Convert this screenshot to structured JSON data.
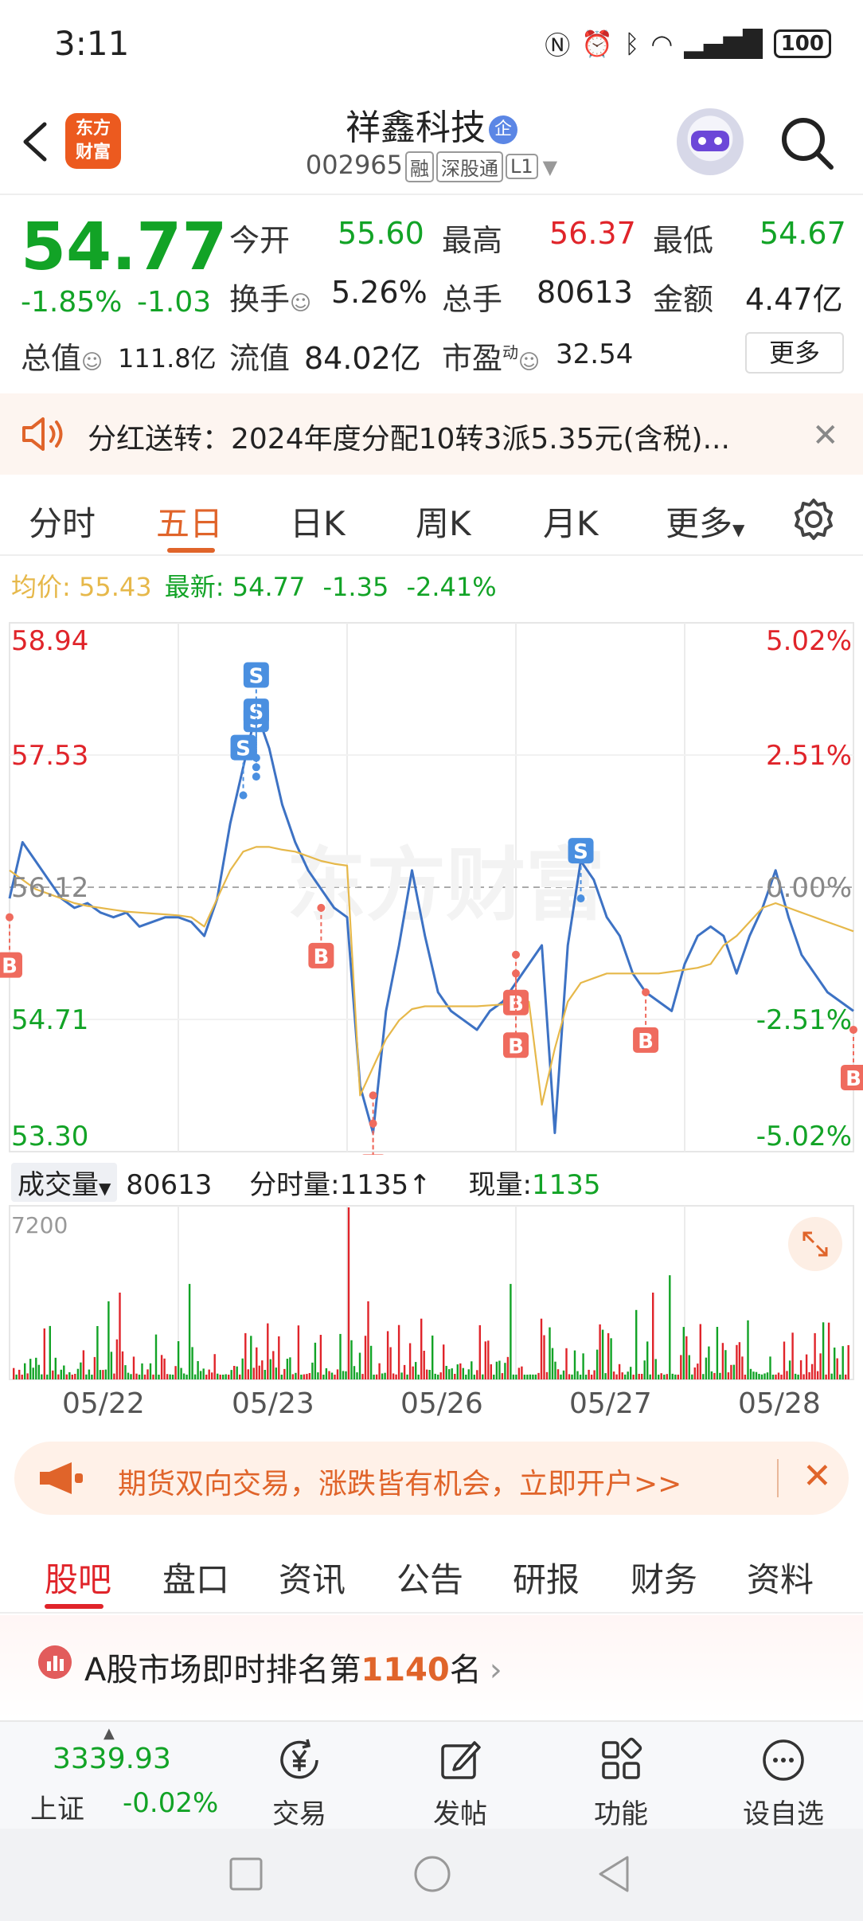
{
  "status_bar": {
    "time": "3:11",
    "battery": "100"
  },
  "header": {
    "app_logo_line1": "东方",
    "app_logo_line2": "财富",
    "stock_name": "祥鑫科技",
    "stock_badge": "企",
    "stock_code": "002965",
    "tags": [
      "融",
      "深股通",
      "L1"
    ]
  },
  "quote": {
    "price": "54.77",
    "change_pct": "-1.85%",
    "change": "-1.03",
    "open_label": "今开",
    "open": "55.60",
    "high_label": "最高",
    "high": "56.37",
    "low_label": "最低",
    "low": "54.67",
    "turnover_label": "换手",
    "turnover": "5.26%",
    "volume_label": "总手",
    "volume": "80613",
    "amount_label": "金额",
    "amount": "4.47亿",
    "mktcap_label": "总值",
    "mktcap": "111.8亿",
    "float_label": "流值",
    "float_cap": "84.02亿",
    "pe_label": "市盈",
    "pe_sup": "动",
    "pe": "32.54",
    "more_label": "更多"
  },
  "dividend": {
    "text": "分红送转：2024年度分配10转3派5.35元(含税)..."
  },
  "chart_tabs": {
    "items": [
      "分时",
      "五日",
      "日K",
      "周K",
      "月K",
      "更多"
    ],
    "active_index": 1
  },
  "avg_row": {
    "avg_label": "均价:",
    "avg_value": "55.43",
    "latest_label": "最新:",
    "latest_value": "54.77",
    "change": "-1.35",
    "change_pct": "-2.41%"
  },
  "chart_data": {
    "type": "line",
    "title": "",
    "watermark": "东方财富",
    "y_left_ticks": [
      "58.94",
      "57.53",
      "56.12",
      "54.71",
      "53.30"
    ],
    "y_right_ticks": [
      "5.02%",
      "2.51%",
      "0.00%",
      "-2.51%",
      "-5.02%"
    ],
    "ylim": [
      53.3,
      58.94
    ],
    "pre_close": 56.12,
    "x_categories": [
      "05/22",
      "05/23",
      "05/26",
      "05/27",
      "05/28"
    ],
    "series": [
      {
        "role": "price",
        "color": "#3d72c4",
        "values": [
          56.0,
          56.6,
          56.4,
          56.2,
          56.0,
          55.9,
          55.95,
          55.85,
          55.8,
          55.85,
          55.7,
          55.75,
          55.8,
          55.8,
          55.75,
          55.6,
          56.0,
          56.8,
          57.4,
          58.0,
          57.6,
          57.0,
          56.6,
          56.3,
          56.1,
          55.9,
          55.8,
          54.0,
          53.5,
          54.8,
          55.5,
          56.3,
          55.6,
          55.0,
          54.8,
          54.7,
          54.6,
          54.8,
          54.9,
          55.1,
          55.3,
          55.5,
          53.5,
          55.5,
          56.4,
          56.2,
          55.8,
          55.6,
          55.2,
          55.0,
          54.9,
          54.8,
          55.3,
          55.6,
          55.7,
          55.6,
          55.2,
          55.6,
          55.9,
          56.3,
          55.8,
          55.4,
          55.2,
          55.0,
          54.9,
          54.8
        ]
      },
      {
        "role": "average",
        "color": "#e6b84a",
        "values": [
          56.3,
          56.2,
          56.1,
          56.05,
          56.0,
          55.95,
          55.92,
          55.9,
          55.88,
          55.86,
          55.85,
          55.84,
          55.83,
          55.82,
          55.8,
          55.7,
          56.0,
          56.3,
          56.5,
          56.55,
          56.55,
          56.52,
          56.5,
          56.45,
          56.4,
          56.37,
          56.35,
          53.9,
          54.2,
          54.5,
          54.7,
          54.82,
          54.85,
          54.85,
          54.85,
          54.85,
          54.85,
          54.86,
          54.87,
          54.88,
          54.9,
          53.8,
          54.4,
          54.9,
          55.1,
          55.15,
          55.2,
          55.2,
          55.2,
          55.2,
          55.2,
          55.22,
          55.24,
          55.26,
          55.3,
          55.5,
          55.6,
          55.75,
          55.9,
          55.95,
          55.9,
          55.85,
          55.8,
          55.75,
          55.7,
          55.65
        ]
      }
    ],
    "trade_markers": [
      {
        "label": "B",
        "x_index": 0,
        "value": 55.8
      },
      {
        "label": "S",
        "x_index": 18,
        "value": 57.1
      },
      {
        "label": "S",
        "x_index": 19,
        "value": 57.4
      },
      {
        "label": "S",
        "x_index": 19,
        "value": 57.3
      },
      {
        "label": "S",
        "x_index": 19,
        "value": 57.5
      },
      {
        "label": "B",
        "x_index": 24,
        "value": 55.9
      },
      {
        "label": "B",
        "x_index": 28,
        "value": 53.6
      },
      {
        "label": "B",
        "x_index": 28,
        "value": 53.9
      },
      {
        "label": "B",
        "x_index": 39,
        "value": 55.4
      },
      {
        "label": "B",
        "x_index": 39,
        "value": 55.2
      },
      {
        "label": "S",
        "x_index": 44,
        "value": 56.0
      },
      {
        "label": "B",
        "x_index": 49,
        "value": 55.0
      },
      {
        "label": "B",
        "x_index": 65,
        "value": 54.6
      }
    ]
  },
  "volume": {
    "selector_label": "成交量",
    "total": "80613",
    "tick_label": "分时量:1135↑",
    "current_label": "现量:",
    "current_value": "1135",
    "max_tick": "7200"
  },
  "ad": {
    "text": "期货双向交易，涨跌皆有机会，立即开户>>"
  },
  "content_tabs": {
    "items": [
      "股吧",
      "盘口",
      "资讯",
      "公告",
      "研报",
      "财务",
      "资料"
    ],
    "active_index": 0
  },
  "ranking": {
    "prefix": "A股市场即时排名第",
    "rank": "1140",
    "suffix": "名"
  },
  "bottom_nav": {
    "index_value": "3339.93",
    "index_label": "上证",
    "index_pct": "-0.02%",
    "items": [
      "交易",
      "发帖",
      "功能",
      "设自选"
    ]
  },
  "colors": {
    "up": "#e0242a",
    "down": "#12a326",
    "accent": "#e0642a",
    "price_line": "#3d72c4",
    "avg_line": "#e6b84a"
  }
}
